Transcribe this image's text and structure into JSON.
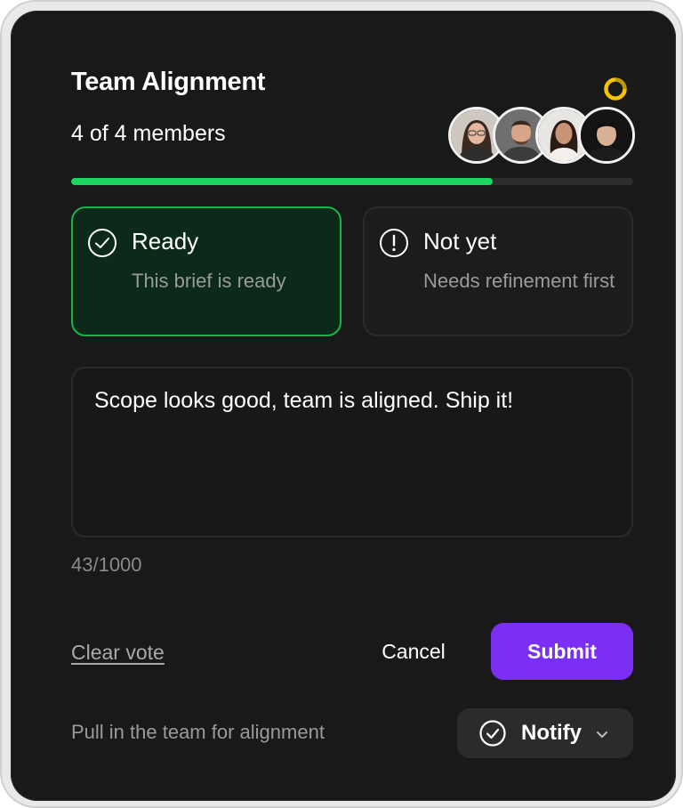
{
  "card": {
    "title": "Team Alignment",
    "members_text": "4 of 4 members",
    "progress_fraction": 0.75,
    "avatars": [
      {
        "name": "avatar-1"
      },
      {
        "name": "avatar-2"
      },
      {
        "name": "avatar-3"
      },
      {
        "name": "avatar-4"
      }
    ]
  },
  "options": {
    "ready": {
      "label": "Ready",
      "description": "This brief is ready",
      "selected": true,
      "icon": "check-circle-icon"
    },
    "not_yet": {
      "label": "Not yet",
      "description": "Needs refinement first",
      "selected": false,
      "icon": "exclamation-circle-icon"
    }
  },
  "comment": {
    "value": "Scope looks good, team is aligned. Ship it!",
    "counter": "43/1000"
  },
  "actions": {
    "clear_vote": "Clear vote",
    "cancel": "Cancel",
    "submit": "Submit"
  },
  "footer": {
    "hint": "Pull in the team for alignment",
    "notify_label": "Notify",
    "notify_icon": "check-circle-icon"
  },
  "colors": {
    "accent_green": "#1ed760",
    "submit_purple": "#7b2ff5",
    "spinner_yellow": "#f5c400",
    "card_bg": "#191919"
  }
}
